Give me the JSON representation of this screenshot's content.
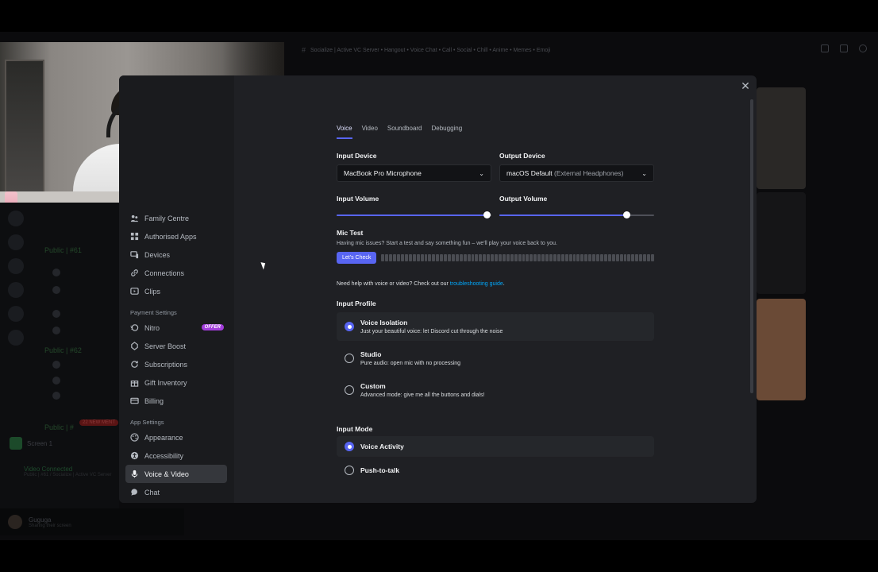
{
  "background": {
    "topbar_title": "Socialize | Active VC Server • Hangout • Voice Chat • Call • Social • Chill • Anime • Memes • Emoji",
    "channels": [
      "Public | #61",
      "Public | #62",
      "Public | #"
    ],
    "new_badge": "22 NEW MENT",
    "screen_label": "Screen 1",
    "voice_connected": "Video Connected",
    "voice_channel": "Public | #61 / Socialize | Active VC Server",
    "username": "Guguga",
    "user_status": "Sharing their screen"
  },
  "sidebar": {
    "items_top": [
      {
        "label": "Family Centre",
        "icon": "family-icon"
      },
      {
        "label": "Authorised Apps",
        "icon": "apps-icon"
      },
      {
        "label": "Devices",
        "icon": "devices-icon"
      },
      {
        "label": "Connections",
        "icon": "link-icon"
      },
      {
        "label": "Clips",
        "icon": "clips-icon"
      }
    ],
    "payment_header": "Payment Settings",
    "payment_items": [
      {
        "label": "Nitro",
        "icon": "nitro-icon",
        "badge": "OFFER"
      },
      {
        "label": "Server Boost",
        "icon": "boost-icon"
      },
      {
        "label": "Subscriptions",
        "icon": "subscriptions-icon"
      },
      {
        "label": "Gift Inventory",
        "icon": "gift-icon"
      },
      {
        "label": "Billing",
        "icon": "billing-icon"
      }
    ],
    "app_header": "App Settings",
    "app_items": [
      {
        "label": "Appearance",
        "icon": "palette-icon"
      },
      {
        "label": "Accessibility",
        "icon": "accessibility-icon"
      },
      {
        "label": "Voice & Video",
        "icon": "microphone-icon",
        "active": true
      },
      {
        "label": "Chat",
        "icon": "chat-icon"
      }
    ]
  },
  "tabs": [
    "Voice",
    "Video",
    "Soundboard",
    "Debugging"
  ],
  "input_device": {
    "label": "Input Device",
    "value": "MacBook Pro Microphone"
  },
  "output_device": {
    "label": "Output Device",
    "value": "macOS Default",
    "value_muted": "(External Headphones)"
  },
  "input_volume": {
    "label": "Input Volume",
    "level": 0.97
  },
  "output_volume": {
    "label": "Output Volume",
    "level": 0.82
  },
  "mic_test": {
    "title": "Mic Test",
    "desc": "Having mic issues? Start a test and say something fun – we'll play your voice back to you.",
    "button": "Let's Check"
  },
  "help": {
    "text": "Need help with voice or video? Check out our ",
    "link": "troubleshooting guide",
    "suffix": "."
  },
  "input_profile": {
    "title": "Input Profile",
    "options": [
      {
        "title": "Voice Isolation",
        "desc": "Just your beautiful voice: let Discord cut through the noise",
        "selected": true
      },
      {
        "title": "Studio",
        "desc": "Pure audio: open mic with no processing",
        "selected": false
      },
      {
        "title": "Custom",
        "desc": "Advanced mode: give me all the buttons and dials!",
        "selected": false
      }
    ]
  },
  "input_mode": {
    "title": "Input Mode",
    "options": [
      {
        "title": "Voice Activity",
        "selected": true
      },
      {
        "title": "Push-to-talk",
        "selected": false
      }
    ]
  },
  "colors": {
    "accent": "#5865f2",
    "offer": "#a23ddb",
    "link": "#00a8fc"
  }
}
